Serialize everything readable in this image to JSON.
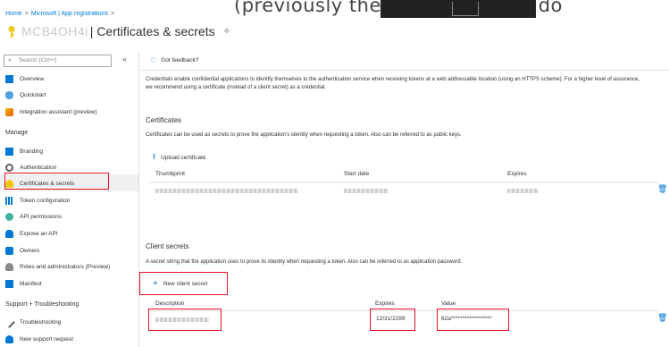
{
  "title_bar": {
    "handwritten_text": "(previously the My, secrets, to do"
  },
  "breadcrumb": {
    "items": [
      "Home",
      "Microsoft | App registrations",
      ""
    ],
    "separator": ">"
  },
  "header": {
    "app_name": "MCB4OH4i",
    "title": "| Certificates & secrets"
  },
  "sidebar": {
    "search_placeholder": "Search (Ctrl+/)",
    "collapse_glyph": "«",
    "items_top": [
      "Overview",
      "Quickstart",
      "Integration assistant (preview)"
    ],
    "section_manage": "Manage",
    "items_manage": [
      "Branding",
      "Authentication",
      "Certificates & secrets",
      "Token configuration",
      "API permissions",
      "Expose an API",
      "Owners",
      "Roles and administrators (Preview)",
      "Manifest"
    ],
    "section_support": "Support + Troubleshooting",
    "items_support": [
      "Troubleshooting",
      "New support request"
    ]
  },
  "content": {
    "feedback": "Got feedback?",
    "intro": "Credentials enable confidential applications to identify themselves to the authentication service when receiving tokens at a web addressable location (using an HTTPS scheme). For a higher level of assurance, we recommend using a certificate (instead of a client secret) as a credential.",
    "certificates": {
      "heading": "Certificates",
      "description": "Certificates can be used as secrets to prove the application's identity when requesting a token. Also can be referred to as public keys.",
      "upload_label": "Upload certificate",
      "columns": [
        "Thumbprint",
        "Start date",
        "Expires"
      ]
    },
    "client_secrets": {
      "heading": "Client secrets",
      "description": "A secret string that the application uses to prove its identity when requesting a token. Also can be referred to as application password.",
      "new_label": "New client secret",
      "columns": [
        "Description",
        "Expires",
        "Value"
      ],
      "row": {
        "expires": "12/31/2299",
        "value": "62a******************"
      }
    }
  },
  "colors": {
    "accent": "#0078d4",
    "highlight": "#e81123"
  }
}
